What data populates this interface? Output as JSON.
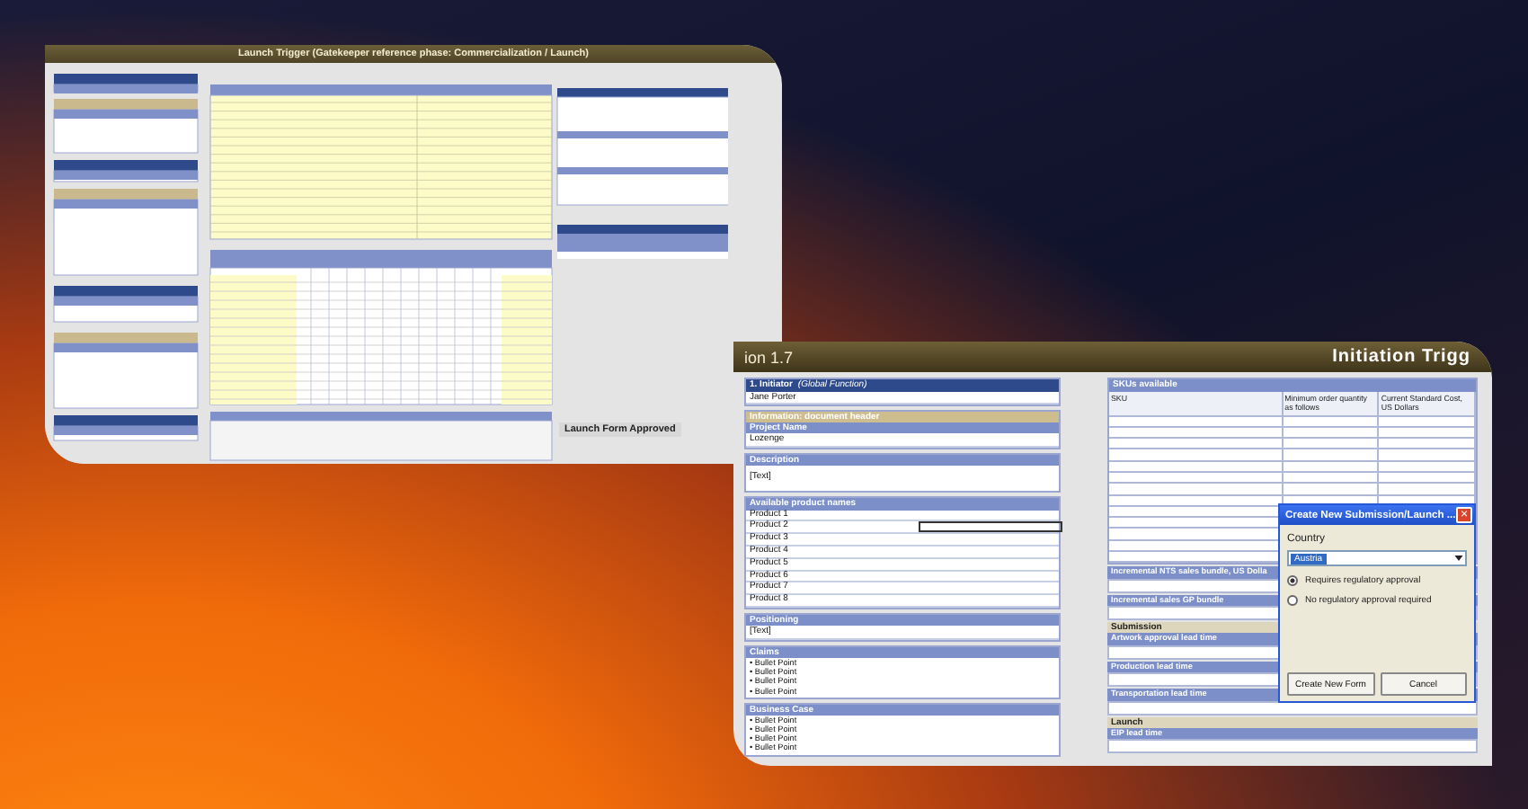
{
  "back_window": {
    "title": "Launch Trigger (Gatekeeper reference phase: Commercialization / Launch)",
    "approval_label": "Launch Form Approved"
  },
  "front_window": {
    "version_label": "ion 1.7",
    "title": "Initiation Trigg",
    "left_sections": [
      {
        "kind": "rows",
        "title": "1. Initiator",
        "note": "(Global Function)",
        "lines": [
          "Jane Porter"
        ]
      },
      {
        "kind": "rows",
        "band": "Information: document header",
        "title": "Project Name",
        "lines": [
          "Lozenge"
        ]
      },
      {
        "kind": "text",
        "title": "Description",
        "lines": [
          "[Text]"
        ]
      },
      {
        "kind": "products",
        "title": "Available product names",
        "items": [
          {
            "text": "Product 1",
            "selected": false
          },
          {
            "text": "Product 2",
            "selected": true
          },
          {
            "text": "Product 3",
            "selected": false
          },
          {
            "text": "Product 4",
            "selected": false
          },
          {
            "text": "Product 5",
            "selected": false
          },
          {
            "text": "Product 6",
            "selected": false
          },
          {
            "text": "Product 7",
            "selected": false
          },
          {
            "text": "Product 8",
            "selected": false
          }
        ]
      },
      {
        "kind": "rows",
        "title": "Positioning",
        "lines": [
          "[Text]"
        ]
      },
      {
        "kind": "bullets",
        "title": "Claims",
        "lines": [
          "• Bullet Point",
          "• Bullet Point",
          "• Bullet Point",
          "• Bullet Point"
        ]
      },
      {
        "kind": "bullets",
        "title": "Business Case",
        "lines": [
          "• Bullet Point",
          "• Bullet Point",
          "• Bullet Point",
          "• Bullet Point"
        ]
      }
    ],
    "sku_table": {
      "title": "SKUs available",
      "columns": [
        "SKU",
        "Minimum order quantity as follows",
        "Current Standard Cost, US Dollars"
      ]
    },
    "right_sections": [
      {
        "title": "Incremental NTS sales bundle, US Dolla"
      },
      {
        "title": "Incremental sales GP bundle"
      },
      {
        "band": "Submission",
        "title": "Artwork approval lead time"
      },
      {
        "title": "Production lead time"
      },
      {
        "title": "Transportation lead time"
      },
      {
        "band": "Launch",
        "title": "EIP lead time"
      }
    ]
  },
  "dialog": {
    "title": "Create New Submission/Launch ...",
    "close": "×",
    "country_label": "Country",
    "country_value": "Austria",
    "options": [
      {
        "label": "Requires regulatory approval",
        "selected": true
      },
      {
        "label": "No regulatory approval required",
        "selected": false
      }
    ],
    "buttons": [
      "Create New Form",
      "Cancel"
    ]
  }
}
